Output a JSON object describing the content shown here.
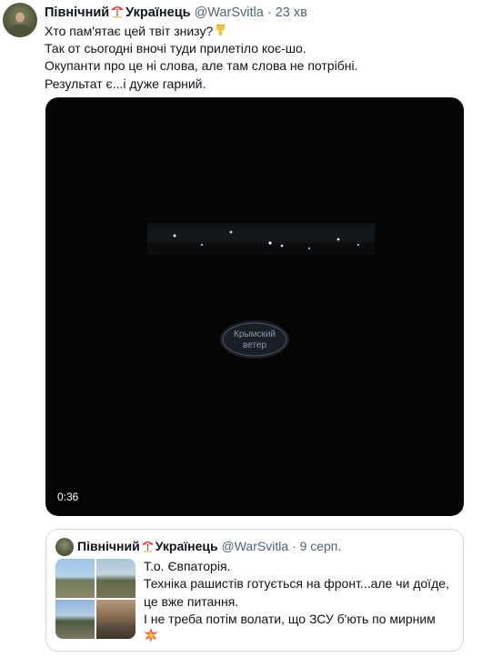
{
  "tweet": {
    "author_name_part1": "Північний",
    "author_name_part2": "Українець",
    "handle": "@WarSvitla",
    "separator": "·",
    "time": "23 хв",
    "lines": [
      "Хто пам'ятає цей твіт знизу?",
      "Так от сьогодні вночі туди прилетіло коє-шо.",
      "Окупанти про це ні слова, але там слова не потрібні.",
      "Результат є...і дуже гарний."
    ],
    "emoji_after_line1": "pointing-down-hand-icon"
  },
  "video": {
    "watermark_line1": "Крымский",
    "watermark_line2": "ветер",
    "duration": "0:36"
  },
  "quote": {
    "author_name_part1": "Північний",
    "author_name_part2": "Українець",
    "handle": "@WarSvitla",
    "separator": "·",
    "time": "9 серп.",
    "lines": [
      "Т.о. Євпаторія.",
      "Техніка рашистів готується на фронт...але чи доїде,",
      "це вже питання.",
      "І не треба потім волати, що ЗСУ б'ють по мирним"
    ],
    "trailing_emoji": "explosion-icon"
  },
  "colors": {
    "text_primary": "#0f1419",
    "text_secondary": "#536471",
    "border": "#cfd9de",
    "media_bg": "#050505"
  }
}
